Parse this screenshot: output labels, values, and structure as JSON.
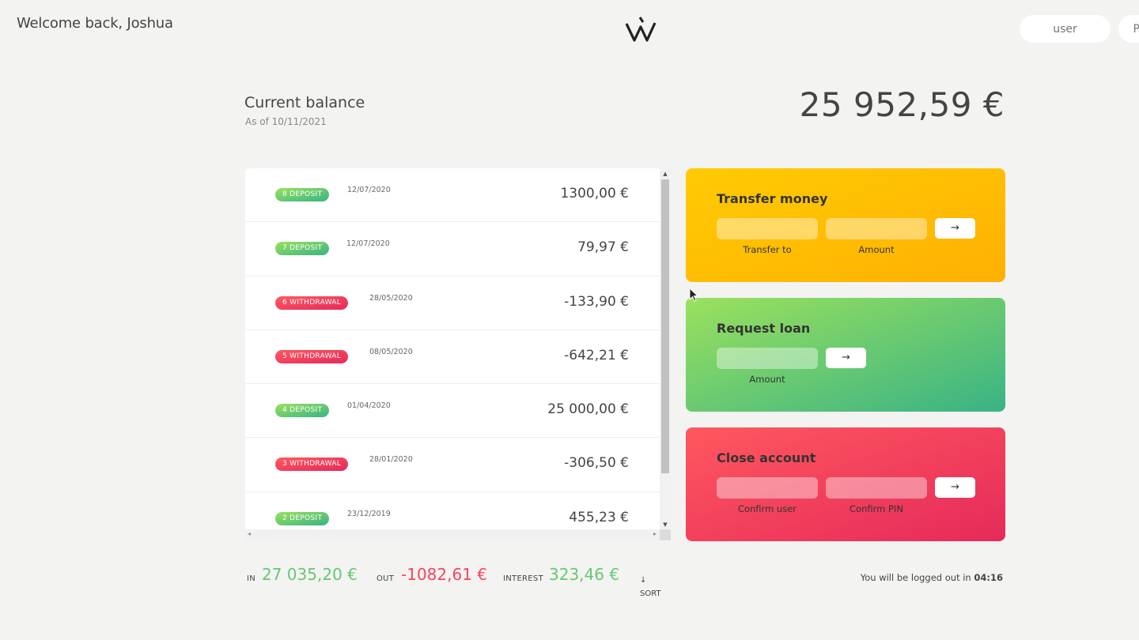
{
  "nav": {
    "welcome": "Welcome back, Joshua",
    "login_user_placeholder": "user",
    "login_pin_placeholder": "PIN"
  },
  "balance": {
    "label": "Current balance",
    "date": "As of 10/11/2021",
    "value": "25 952,59 €"
  },
  "movements": [
    {
      "type_label": "8 deposit",
      "kind": "deposit",
      "date": "12/07/2020",
      "value": "1300,00 €"
    },
    {
      "type_label": "7 deposit",
      "kind": "deposit",
      "date": "12/07/2020",
      "value": "79,97 €"
    },
    {
      "type_label": "6 withdrawal",
      "kind": "withdrawal",
      "date": "28/05/2020",
      "value": "-133,90 €"
    },
    {
      "type_label": "5 withdrawal",
      "kind": "withdrawal",
      "date": "08/05/2020",
      "value": "-642,21 €"
    },
    {
      "type_label": "4 deposit",
      "kind": "deposit",
      "date": "01/04/2020",
      "value": "25 000,00 €"
    },
    {
      "type_label": "3 withdrawal",
      "kind": "withdrawal",
      "date": "28/01/2020",
      "value": "-306,50 €"
    },
    {
      "type_label": "2 deposit",
      "kind": "deposit",
      "date": "23/12/2019",
      "value": "455,23 €"
    }
  ],
  "operations": {
    "transfer": {
      "title": "Transfer money",
      "label_to": "Transfer to",
      "label_amount": "Amount",
      "button": "→"
    },
    "loan": {
      "title": "Request loan",
      "label_amount": "Amount",
      "button": "→"
    },
    "close": {
      "title": "Close account",
      "label_user": "Confirm user",
      "label_pin": "Confirm PIN",
      "button": "→"
    }
  },
  "summary": {
    "in_label": "In",
    "in_value": "27 035,20 €",
    "out_label": "Out",
    "out_value": "-1082,61 €",
    "interest_label": "Interest",
    "interest_value": "323,46 €",
    "sort_arrow": "↓",
    "sort_label": "SORT"
  },
  "logout": {
    "text": "You will be logged out in",
    "timer": "04:16"
  },
  "colors": {
    "deposit": "#66c873",
    "withdrawal": "#f5465d",
    "transfer_card": "#ffc003",
    "loan_card": "#6ccb6d",
    "close_card": "#f04060"
  }
}
